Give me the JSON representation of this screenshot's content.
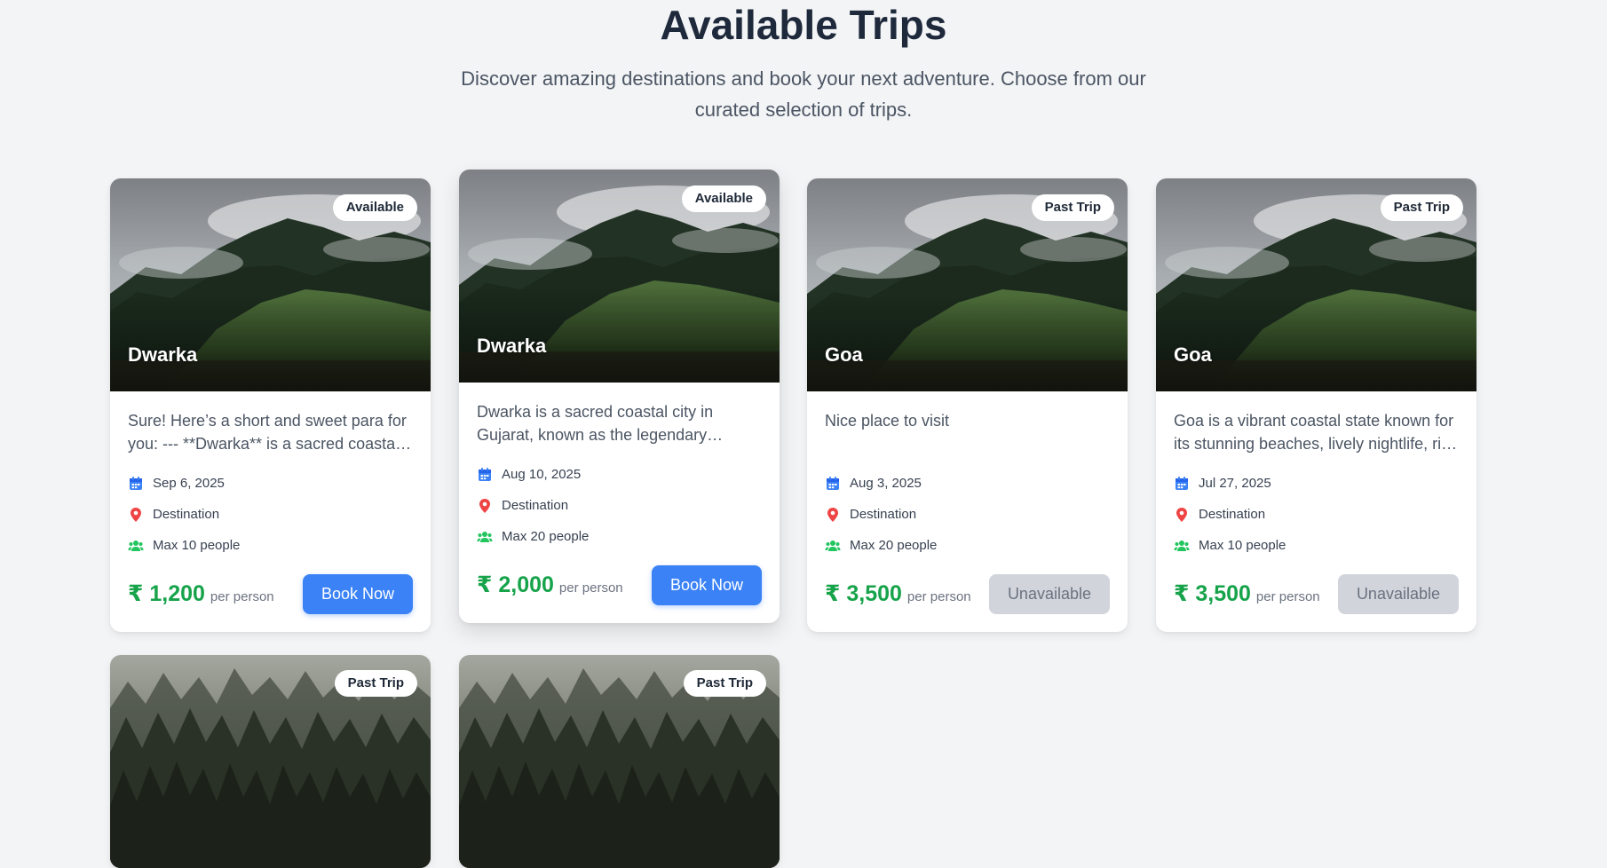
{
  "header": {
    "title": "Available Trips",
    "subtitle": "Discover amazing destinations and book your next adventure. Choose from our curated selection of trips."
  },
  "currency_symbol": "₹",
  "per_person_label": "per person",
  "colors": {
    "accent": "#3b82f6",
    "price": "#16a34a",
    "location": "#ef4444",
    "people": "#22c55e",
    "unavailable": "#d1d5db"
  },
  "icons": {
    "date": "calendar-icon",
    "location": "map-pin-icon",
    "people": "users-icon"
  },
  "trips": [
    {
      "badge": "Available",
      "title": "Dwarka",
      "description": "Sure! Here’s a short and sweet para for you: --- **Dwarka** is a sacred coastal city in Gujarat, known as the legendary kingdom of Lord Krishna.",
      "date": "Sep 6, 2025",
      "location": "Destination",
      "capacity": "Max 10 people",
      "price": "1,200",
      "action": "Book Now"
    },
    {
      "badge": "Available",
      "title": "Dwarka",
      "description": "Dwarka is a sacred coastal city in Gujarat, known as the legendary kingdom of Lord Krishna.",
      "date": "Aug 10, 2025",
      "location": "Destination",
      "capacity": "Max 20 people",
      "price": "2,000",
      "action": "Book Now"
    },
    {
      "badge": "Past Trip",
      "title": "Goa",
      "description": "Nice place to visit",
      "date": "Aug 3, 2025",
      "location": "Destination",
      "capacity": "Max 20 people",
      "price": "3,500",
      "action": "Unavailable"
    },
    {
      "badge": "Past Trip",
      "title": "Goa",
      "description": "Goa is a vibrant coastal state known for its stunning beaches, lively nightlife, rich Portuguese heritage and delicious seafood.",
      "date": "Jul 27, 2025",
      "location": "Destination",
      "capacity": "Max 10 people",
      "price": "3,500",
      "action": "Unavailable"
    },
    {
      "badge": "Past Trip"
    },
    {
      "badge": "Past Trip"
    }
  ]
}
